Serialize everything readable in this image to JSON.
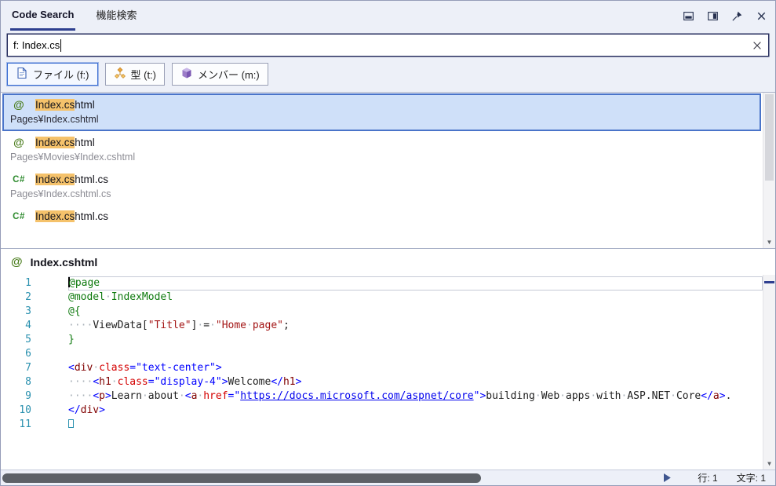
{
  "colors": {
    "accent": "#2e3f8f",
    "match_highlight": "#f5c26b",
    "selection_bg": "#cfe0f9",
    "selection_border": "#4a74c9",
    "line_number": "#2b91af",
    "razor": "#0e7a0e",
    "string": "#a31515",
    "delim": "#0000ff",
    "tag": "#800000",
    "attr": "#d40000",
    "attrval": "#0000ff",
    "url": "#0000ee"
  },
  "tabs": [
    {
      "name": "code-search",
      "label": "Code Search",
      "active": true
    },
    {
      "name": "feature-search",
      "label": "機能検索",
      "active": false
    }
  ],
  "window_buttons": [
    "dock-bottom-icon",
    "split-vertical-icon",
    "pin-icon",
    "close-icon"
  ],
  "search": {
    "value": "f: Index.cs"
  },
  "filters": [
    {
      "name": "file",
      "icon": "file-icon",
      "label": "ファイル (f:)",
      "selected": true
    },
    {
      "name": "type",
      "icon": "type-icon",
      "label": "型 (t:)",
      "selected": false
    },
    {
      "name": "member",
      "icon": "member-icon",
      "label": "メンバー (m:)",
      "selected": false
    }
  ],
  "results": [
    {
      "icon": "razor",
      "icon_text": "@",
      "match": "Index.cs",
      "rest": "html",
      "path": "Pages¥Index.cshtml",
      "selected": true
    },
    {
      "icon": "razor",
      "icon_text": "@",
      "match": "Index.cs",
      "rest": "html",
      "path": "Pages¥Movies¥Index.cshtml",
      "selected": false
    },
    {
      "icon": "csharp",
      "icon_text": "C#",
      "match": "Index.cs",
      "rest": "html.cs",
      "path": "Pages¥Index.cshtml.cs",
      "selected": false
    },
    {
      "icon": "csharp",
      "icon_text": "C#",
      "match": "Index.cs",
      "rest": "html.cs",
      "path": null,
      "selected": false
    }
  ],
  "preview": {
    "icon_text": "@",
    "title": "Index.cshtml",
    "code_lines": [
      {
        "num": "1",
        "current": true,
        "caret": true,
        "segments": [
          {
            "k": "razor",
            "t": "@page"
          }
        ]
      },
      {
        "num": "2",
        "segments": [
          {
            "k": "razor",
            "t": "@model"
          },
          {
            "k": "ws",
            "t": "·"
          },
          {
            "k": "razor",
            "t": "IndexModel"
          }
        ]
      },
      {
        "num": "3",
        "segments": [
          {
            "k": "razor",
            "t": "@{"
          }
        ]
      },
      {
        "num": "4",
        "segments": [
          {
            "k": "ws",
            "t": "····"
          },
          {
            "k": "code",
            "t": "ViewData["
          },
          {
            "k": "string",
            "t": "\"Title\""
          },
          {
            "k": "code",
            "t": "]"
          },
          {
            "k": "ws",
            "t": "·"
          },
          {
            "k": "code",
            "t": "="
          },
          {
            "k": "ws",
            "t": "·"
          },
          {
            "k": "string",
            "t": "\"Home"
          },
          {
            "k": "ws",
            "t": "·"
          },
          {
            "k": "string",
            "t": "page\""
          },
          {
            "k": "code",
            "t": ";"
          }
        ]
      },
      {
        "num": "5",
        "segments": [
          {
            "k": "razor",
            "t": "}"
          }
        ]
      },
      {
        "num": "6",
        "segments": []
      },
      {
        "num": "7",
        "segments": [
          {
            "k": "delim",
            "t": "<"
          },
          {
            "k": "tag",
            "t": "div"
          },
          {
            "k": "ws",
            "t": "·"
          },
          {
            "k": "attr",
            "t": "class"
          },
          {
            "k": "delim",
            "t": "="
          },
          {
            "k": "attrval",
            "t": "\"text-center\""
          },
          {
            "k": "delim",
            "t": ">"
          }
        ]
      },
      {
        "num": "8",
        "segments": [
          {
            "k": "ws",
            "t": "····"
          },
          {
            "k": "delim",
            "t": "<"
          },
          {
            "k": "tag",
            "t": "h1"
          },
          {
            "k": "ws",
            "t": "·"
          },
          {
            "k": "attr",
            "t": "class"
          },
          {
            "k": "delim",
            "t": "="
          },
          {
            "k": "attrval",
            "t": "\"display-4\""
          },
          {
            "k": "delim",
            "t": ">"
          },
          {
            "k": "text",
            "t": "Welcome"
          },
          {
            "k": "delim",
            "t": "</"
          },
          {
            "k": "tag",
            "t": "h1"
          },
          {
            "k": "delim",
            "t": ">"
          }
        ]
      },
      {
        "num": "9",
        "segments": [
          {
            "k": "ws",
            "t": "····"
          },
          {
            "k": "delim",
            "t": "<"
          },
          {
            "k": "tag",
            "t": "p"
          },
          {
            "k": "delim",
            "t": ">"
          },
          {
            "k": "text",
            "t": "Learn"
          },
          {
            "k": "ws",
            "t": "·"
          },
          {
            "k": "text",
            "t": "about"
          },
          {
            "k": "ws",
            "t": "·"
          },
          {
            "k": "delim",
            "t": "<"
          },
          {
            "k": "tag",
            "t": "a"
          },
          {
            "k": "ws",
            "t": "·"
          },
          {
            "k": "attr",
            "t": "href"
          },
          {
            "k": "delim",
            "t": "="
          },
          {
            "k": "attrval",
            "t": "\""
          },
          {
            "k": "url",
            "t": "https://docs.microsoft.com/aspnet/core"
          },
          {
            "k": "attrval",
            "t": "\""
          },
          {
            "k": "delim",
            "t": ">"
          },
          {
            "k": "text",
            "t": "building"
          },
          {
            "k": "ws",
            "t": "·"
          },
          {
            "k": "text",
            "t": "Web"
          },
          {
            "k": "ws",
            "t": "·"
          },
          {
            "k": "text",
            "t": "apps"
          },
          {
            "k": "ws",
            "t": "·"
          },
          {
            "k": "text",
            "t": "with"
          },
          {
            "k": "ws",
            "t": "·"
          },
          {
            "k": "text",
            "t": "ASP.NET"
          },
          {
            "k": "ws",
            "t": "·"
          },
          {
            "k": "text",
            "t": "Core"
          },
          {
            "k": "delim",
            "t": "</"
          },
          {
            "k": "tag",
            "t": "a"
          },
          {
            "k": "delim",
            "t": ">"
          },
          {
            "k": "text",
            "t": "."
          }
        ]
      },
      {
        "num": "10",
        "segments": [
          {
            "k": "delim",
            "t": "</"
          },
          {
            "k": "tag",
            "t": "div"
          },
          {
            "k": "delim",
            "t": ">"
          }
        ]
      },
      {
        "num": "11",
        "segments": [
          {
            "k": "box",
            "t": ""
          }
        ]
      }
    ]
  },
  "statusbar": {
    "line_label": "行: 1",
    "column_label": "文字: 1"
  }
}
